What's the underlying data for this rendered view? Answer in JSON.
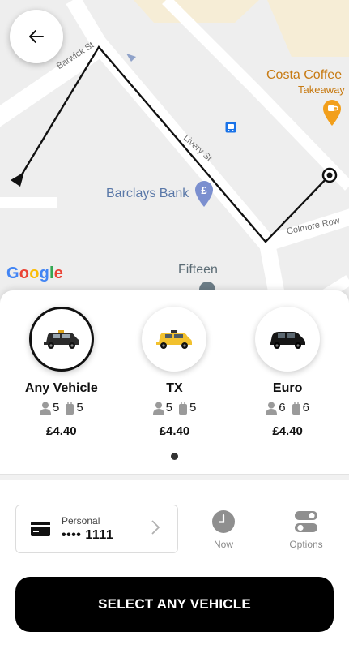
{
  "map": {
    "labels": {
      "costa": "Costa Coffee",
      "takeaway": "Takeaway",
      "barclays": "Barclays Bank",
      "fifteen": "Fifteen",
      "barwick": "Barwick St",
      "livery": "Livery St",
      "colmore": "Colmore Row"
    },
    "google_logo": [
      "G",
      "o",
      "o",
      "g",
      "l",
      "e"
    ],
    "colors": {
      "route": "#111111",
      "road": "#ffffff",
      "background": "#eeeeee",
      "building": "#f6edd6",
      "poi_food": "#f29f1b",
      "poi_bank": "#7b8fcf",
      "poi_transit": "#1a73e8"
    }
  },
  "back_button": {
    "icon": "arrow-left-icon"
  },
  "vehicles": [
    {
      "name": "Any Vehicle",
      "passengers": "5",
      "luggage": "5",
      "price": "£4.40",
      "selected": true,
      "icon": "black-cab-icon"
    },
    {
      "name": "TX",
      "passengers": "5",
      "luggage": "5",
      "price": "£4.40",
      "selected": false,
      "icon": "yellow-taxi-icon"
    },
    {
      "name": "Euro",
      "passengers": "6",
      "luggage": "6",
      "price": "£4.40",
      "selected": false,
      "icon": "black-van-icon"
    }
  ],
  "payment": {
    "type": "Personal",
    "number": "•••• 1111",
    "icon": "credit-card-icon"
  },
  "options": {
    "now_label": "Now",
    "options_label": "Options"
  },
  "cta": {
    "label": "SELECT ANY VEHICLE"
  }
}
